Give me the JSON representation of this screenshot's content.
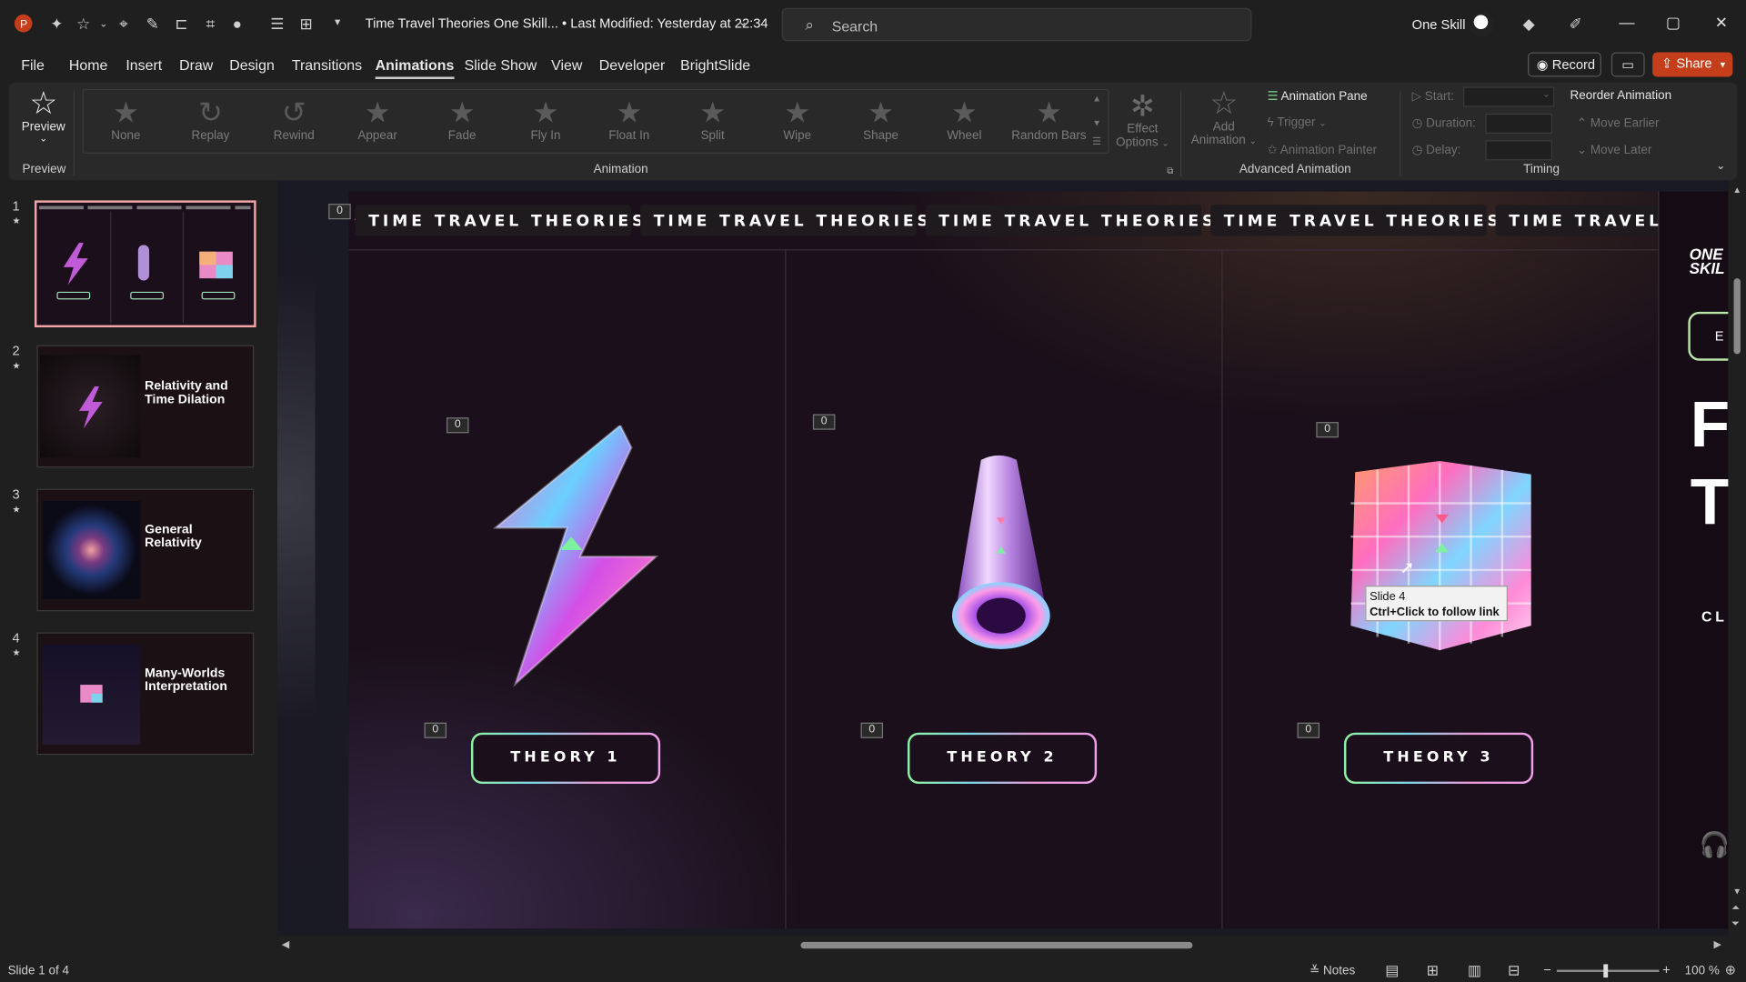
{
  "titlebar": {
    "app_icon": "powerpoint-logo-icon",
    "doc_title": "Time Travel Theories One Skill... • Last Modified: Yesterday at 22:34",
    "search_placeholder": "Search",
    "user_name": "One Skill"
  },
  "menu": {
    "tabs": [
      "File",
      "Home",
      "Insert",
      "Draw",
      "Design",
      "Transitions",
      "Animations",
      "Slide Show",
      "View",
      "Developer",
      "BrightSlide"
    ],
    "active": "Animations",
    "record": "Record",
    "share": "Share"
  },
  "ribbon": {
    "preview_label": "Preview",
    "preview_group": "Preview",
    "gallery": [
      "None",
      "Replay",
      "Rewind",
      "Appear",
      "Fade",
      "Fly In",
      "Float In",
      "Split",
      "Wipe",
      "Shape",
      "Wheel",
      "Random Bars"
    ],
    "effect_options": [
      "Effect",
      "Options"
    ],
    "animation_group": "Animation",
    "add_animation": [
      "Add",
      "Animation"
    ],
    "animation_pane": "Animation Pane",
    "trigger": "Trigger",
    "animation_painter": "Animation Painter",
    "advanced_group": "Advanced Animation",
    "start": "Start:",
    "duration": "Duration:",
    "delay": "Delay:",
    "reorder": "Reorder Animation",
    "move_earlier": "Move Earlier",
    "move_later": "Move Later",
    "timing_group": "Timing"
  },
  "thumbnails": [
    {
      "num": "1",
      "title": "",
      "selected": true
    },
    {
      "num": "2",
      "title": "Relativity and Time Dilation"
    },
    {
      "num": "3",
      "title": "General Relativity"
    },
    {
      "num": "4",
      "title": "Many-Worlds Interpretation"
    }
  ],
  "slide": {
    "banner": [
      "TIME TRAVEL THEORIES",
      "TIME TRAVEL THEORIES",
      "TIME TRAVEL THEORIES",
      "TIME TRAVEL THEORIES",
      "TIME TRAVEL THEOR"
    ],
    "anim_tag": "0",
    "theories": [
      "THEORY 1",
      "THEORY 2",
      "THEORY 3"
    ],
    "tooltip_line1": "Slide 4",
    "tooltip_line2": "Ctrl+Click to follow link",
    "next_slide": {
      "logo_line1": "ONE",
      "logo_line2": "SKIL",
      "button_letter": "E",
      "big_letter_1": "F",
      "big_letter_2": "T",
      "small_text": "CL"
    }
  },
  "status": {
    "slide_info": "Slide 1 of 4",
    "notes": "Notes",
    "zoom": "100 %"
  }
}
